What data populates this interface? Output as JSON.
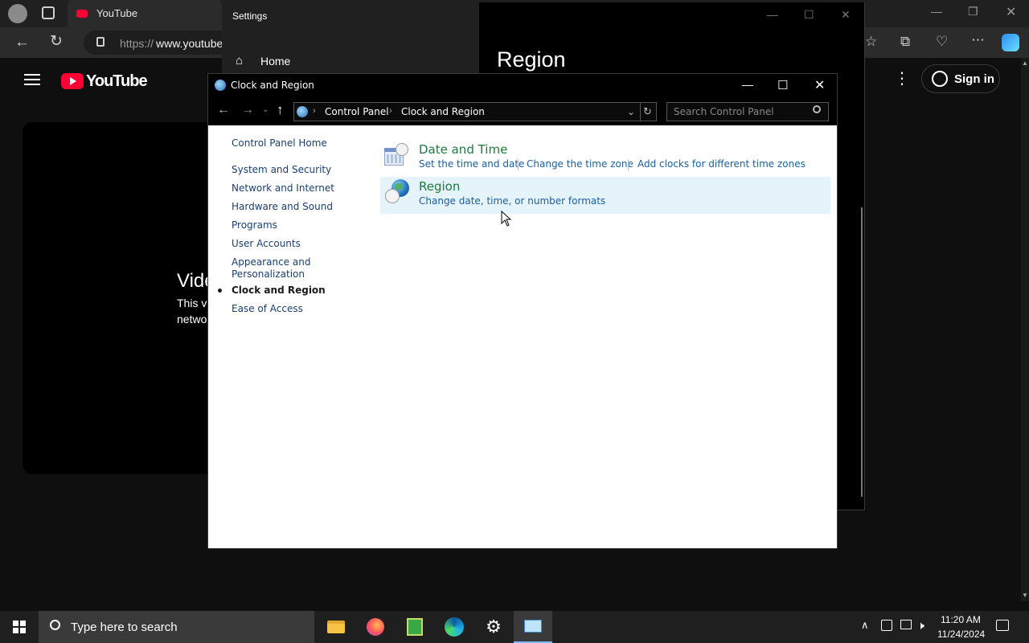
{
  "edge": {
    "tab_title": "YouTube",
    "url_scheme": "https://",
    "url_domain": "www.youtube"
  },
  "youtube": {
    "logo_text": "YouTube",
    "sign_in_label": "Sign in",
    "video_title_partial": "Vide",
    "video_msg_line1": "This v",
    "video_msg_line2": "netwo"
  },
  "settings": {
    "title": "Settings",
    "home_label": "Home",
    "page_title": "Region"
  },
  "control_panel": {
    "window_title": "Clock and Region",
    "breadcrumb": [
      "Control Panel",
      "Clock and Region"
    ],
    "search_placeholder": "Search Control Panel",
    "nav": {
      "home": "Control Panel Home",
      "items": [
        "System and Security",
        "Network and Internet",
        "Hardware and Sound",
        "Programs",
        "User Accounts",
        "Appearance and Personalization",
        "Clock and Region",
        "Ease of Access"
      ],
      "appearance_line1": "Appearance and",
      "appearance_line2": "Personalization",
      "current": "Clock and Region"
    },
    "categories": [
      {
        "title": "Date and Time",
        "icon": "calendar-clock-icon",
        "tasks": [
          "Set the time and date",
          "Change the time zone",
          "Add clocks for different time zones"
        ]
      },
      {
        "title": "Region",
        "icon": "globe-clock-icon",
        "tasks": [
          "Change date, time, or number formats"
        ]
      }
    ]
  },
  "taskbar": {
    "search_placeholder": "Type here to search",
    "time": "11:20 AM",
    "date": "11/24/2024",
    "apps": [
      "file-explorer-icon",
      "firefox-icon",
      "task-app-icon",
      "edge-icon",
      "settings-icon",
      "control-panel-icon"
    ]
  },
  "colors": {
    "link_green": "#1e7a3c",
    "link_blue": "#1a5e9e",
    "highlight": "#e5f3fb"
  }
}
